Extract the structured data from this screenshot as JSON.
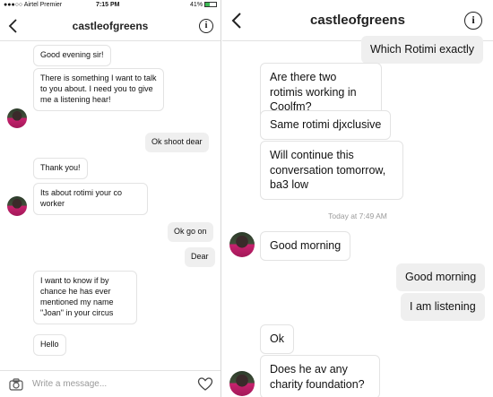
{
  "status_bar": {
    "carrier": "●●●○○ Airtel Premier ",
    "time": "7:15 PM",
    "battery": "41%",
    "battery_level": 0.41
  },
  "left": {
    "title": "castleofgreens",
    "messages": [
      {
        "dir": "in",
        "text": "Good evening sir!"
      },
      {
        "dir": "in",
        "text": "There is something I want to talk to you about. I need you to give me a listening hear!"
      },
      {
        "dir": "out",
        "text": "Ok shoot dear"
      },
      {
        "dir": "in",
        "text": "Thank you!"
      },
      {
        "dir": "in",
        "text": "Its about rotimi your co worker"
      },
      {
        "dir": "out",
        "text": "Ok go on"
      },
      {
        "dir": "out",
        "text": "Dear"
      },
      {
        "dir": "in",
        "text": "I want to know if by chance he has ever mentioned my name \"Joan\" in your circus"
      },
      {
        "dir": "in",
        "text": "Hello"
      }
    ],
    "composer": {
      "placeholder": "Write a message..."
    }
  },
  "right": {
    "title": "castleofgreens",
    "timestamp": "Today at 7:49 AM",
    "messages": [
      {
        "dir": "out",
        "text": "Which Rotimi exactly"
      },
      {
        "dir": "in",
        "text": "Are there two rotimis working in Coolfm?"
      },
      {
        "dir": "in",
        "text": "Same rotimi djxclusive"
      },
      {
        "dir": "in",
        "text": "Will continue this conversation tomorrow, ba3 low"
      },
      {
        "dir": "in",
        "text": "Good morning"
      },
      {
        "dir": "out",
        "text": "Good morning"
      },
      {
        "dir": "out",
        "text": "I am listening"
      },
      {
        "dir": "in",
        "text": "Ok"
      },
      {
        "dir": "in",
        "text": "Does he av any charity foundation?"
      }
    ]
  },
  "icons": {
    "back": "chevron-left-icon",
    "info": "info-icon",
    "camera": "camera-icon",
    "like": "heart-icon"
  },
  "colors": {
    "outgoing_bubble": "#efefef",
    "incoming_border": "#e3e3e3",
    "battery": "#3cba54"
  }
}
